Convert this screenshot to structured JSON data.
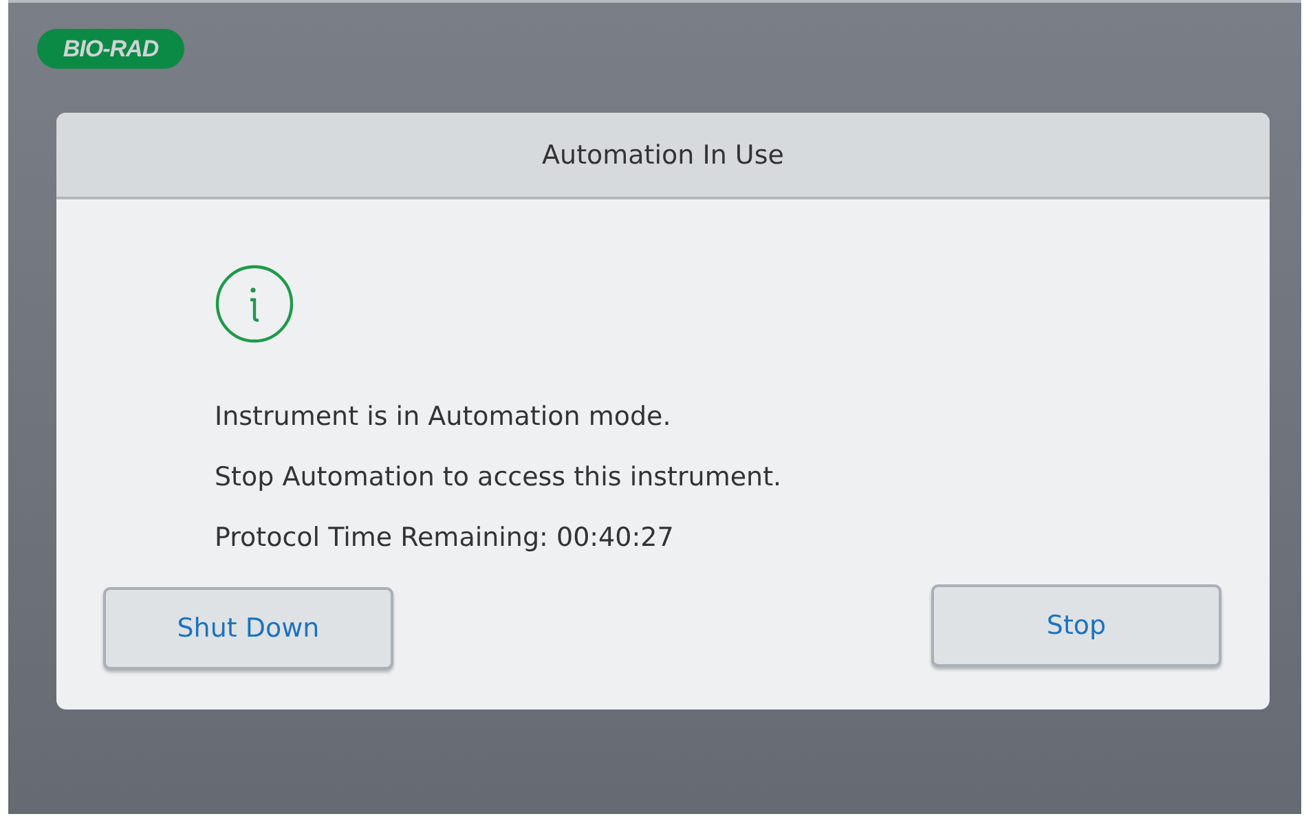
{
  "logo": "BIO-RAD",
  "dialog": {
    "title": "Automation In Use",
    "messages": [
      "Instrument is in Automation mode.",
      "Stop Automation to access this instrument.",
      "Protocol Time Remaining: 00:40:27"
    ],
    "buttons": [
      {
        "label": "Shut Down"
      },
      {
        "label": "Stop"
      }
    ]
  }
}
